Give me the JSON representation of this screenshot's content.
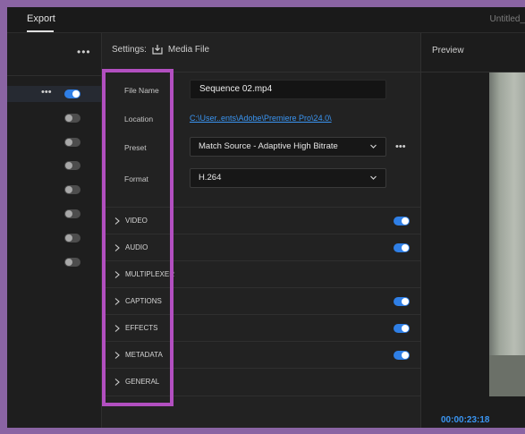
{
  "window": {
    "tab_label": "Export",
    "title": "Untitled_"
  },
  "left_panel": {
    "more_label": "•••"
  },
  "settings": {
    "header_label": "Settings:",
    "target_label": "Media File",
    "fields": {
      "file_name_label": "File Name",
      "file_name_value": "Sequence 02.mp4",
      "location_label": "Location",
      "location_value": "C:\\User..ents\\Adobe\\Premiere Pro\\24.0\\",
      "preset_label": "Preset",
      "preset_value": "Match Source - Adaptive High Bitrate",
      "preset_more_label": "•••",
      "format_label": "Format",
      "format_value": "H.264"
    },
    "sections": [
      {
        "label": "VIDEO",
        "enabled": true
      },
      {
        "label": "AUDIO",
        "enabled": true
      },
      {
        "label": "MULTIPLEXER",
        "enabled": null
      },
      {
        "label": "CAPTIONS",
        "enabled": true
      },
      {
        "label": "EFFECTS",
        "enabled": true
      },
      {
        "label": "METADATA",
        "enabled": true
      },
      {
        "label": "GENERAL",
        "enabled": null
      }
    ]
  },
  "preview": {
    "title": "Preview",
    "timecode": "00:00:23:18"
  },
  "accent_color": "#2f7fe6",
  "highlight_color": "#b24fc0"
}
